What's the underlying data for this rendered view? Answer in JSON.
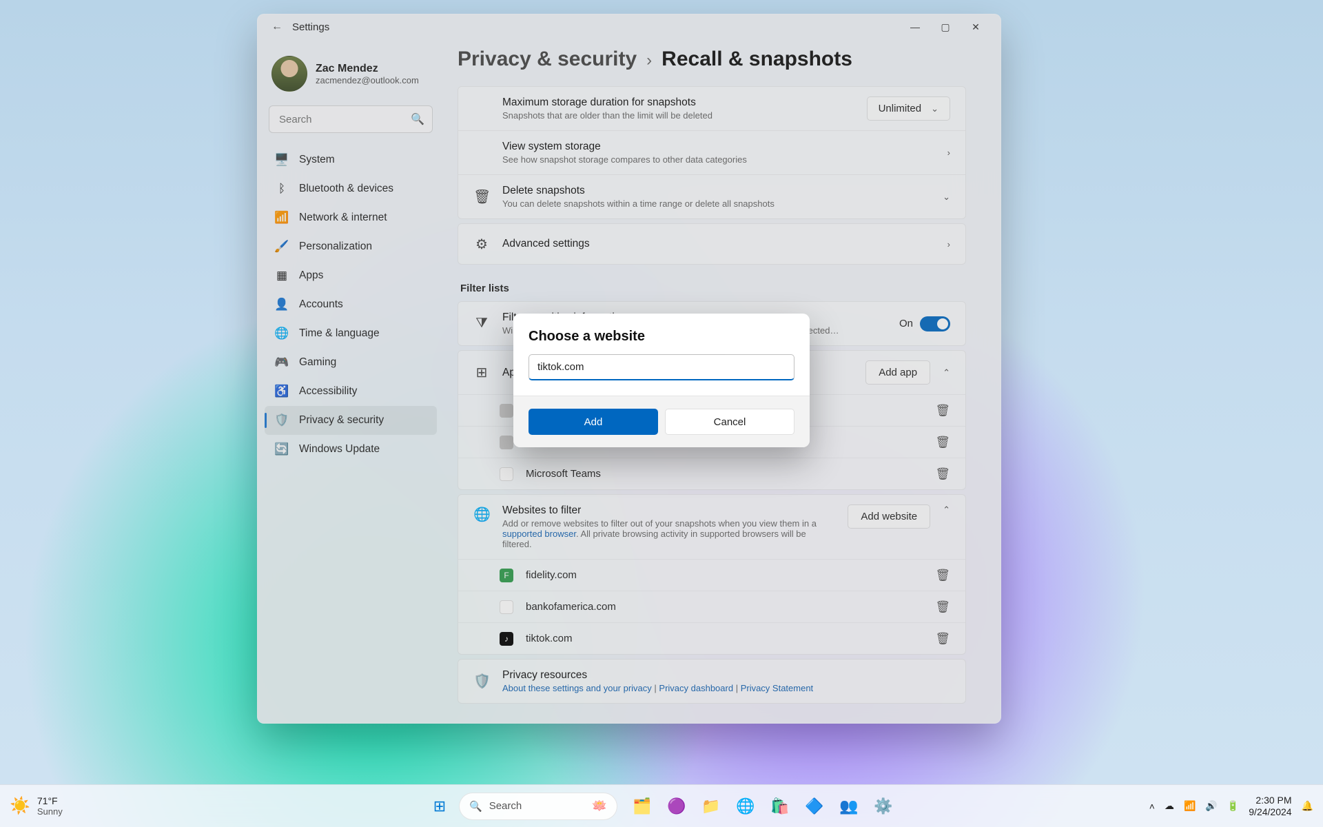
{
  "window": {
    "app_title": "Settings",
    "user": {
      "name": "Zac Mendez",
      "email": "zacmendez@outlook.com"
    },
    "search_placeholder": "Search",
    "nav": [
      {
        "label": "System",
        "icon": "🖥️"
      },
      {
        "label": "Bluetooth & devices",
        "icon": "ᛒ"
      },
      {
        "label": "Network & internet",
        "icon": "📶"
      },
      {
        "label": "Personalization",
        "icon": "🖌️"
      },
      {
        "label": "Apps",
        "icon": "▦"
      },
      {
        "label": "Accounts",
        "icon": "👤"
      },
      {
        "label": "Time & language",
        "icon": "🌐"
      },
      {
        "label": "Gaming",
        "icon": "🎮"
      },
      {
        "label": "Accessibility",
        "icon": "♿"
      },
      {
        "label": "Privacy & security",
        "icon": "🛡️"
      },
      {
        "label": "Windows Update",
        "icon": "🔄"
      }
    ],
    "nav_active_index": 9
  },
  "breadcrumb": {
    "parent": "Privacy & security",
    "leaf": "Recall & snapshots"
  },
  "settings": {
    "max_storage": {
      "title": "Maximum storage duration for snapshots",
      "sub": "Snapshots that are older than the limit will be deleted",
      "value": "Unlimited"
    },
    "view_storage": {
      "title": "View system storage",
      "sub": "See how snapshot storage compares to other data categories"
    },
    "delete": {
      "title": "Delete snapshots",
      "sub": "You can delete snapshots within a time range or delete all snapshots"
    },
    "advanced": {
      "title": "Advanced settings"
    },
    "section_filter": "Filter lists",
    "filter_sensitive": {
      "title": "Filter sensitive information",
      "sub": "Windows will not save snapshots when potentially sensitive information is detected…",
      "state_label": "On"
    },
    "apps_to_filter": {
      "title": "Apps to filter",
      "btn": "Add app",
      "items": [
        "",
        "",
        "Microsoft Teams"
      ]
    },
    "sites_to_filter": {
      "title": "Websites to filter",
      "btn": "Add website",
      "sub_pre": "Add or remove websites to filter out of your snapshots when you view them in a ",
      "sub_link": "supported browser",
      "sub_post": ". All private browsing activity in supported browsers will be filtered.",
      "items": [
        "fidelity.com",
        "bankofamerica.com",
        "tiktok.com"
      ]
    },
    "privacy_res": {
      "title": "Privacy resources",
      "links": [
        "About these settings and your privacy",
        "Privacy dashboard",
        "Privacy Statement"
      ]
    }
  },
  "dialog": {
    "title": "Choose a website",
    "value": "tiktok.com",
    "add": "Add",
    "cancel": "Cancel"
  },
  "taskbar": {
    "weather": {
      "temp": "71°F",
      "cond": "Sunny"
    },
    "search": "Search",
    "clock": {
      "time": "2:30 PM",
      "date": "9/24/2024"
    }
  }
}
